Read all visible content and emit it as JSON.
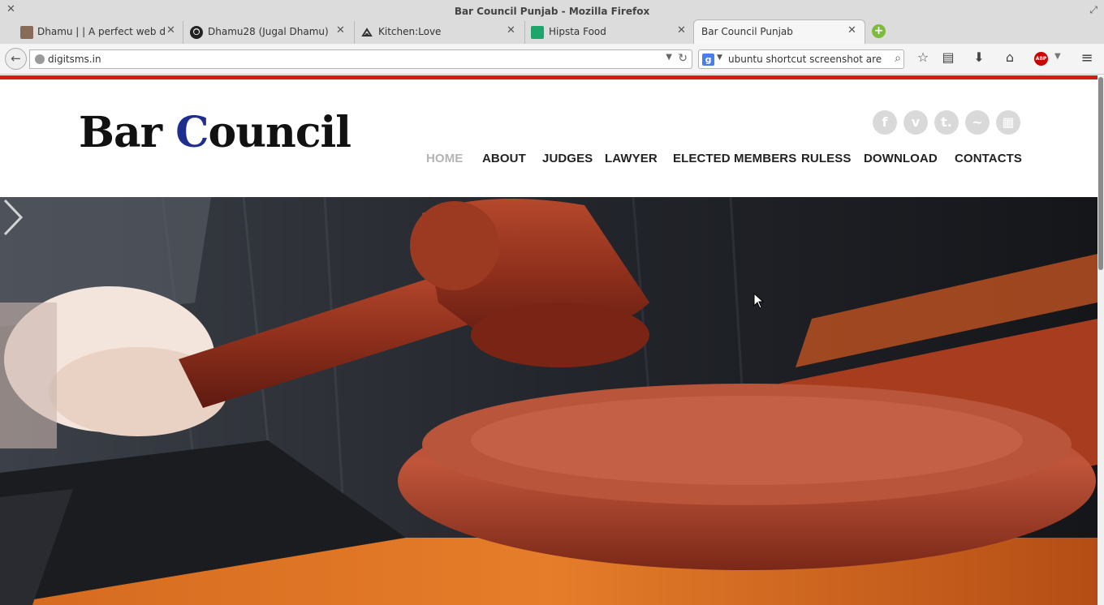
{
  "window": {
    "title": "Bar Council Punjab - Mozilla Firefox"
  },
  "tabs": [
    {
      "label": "Dhamu | | A perfect web d…",
      "favicon": "avatar-photo"
    },
    {
      "label": "Dhamu28 (Jugal Dhamu)",
      "favicon": "github-icon"
    },
    {
      "label": "Kitchen:Love",
      "favicon": "kitchen-icon"
    },
    {
      "label": "Hipsta Food",
      "favicon": "hipsta-icon"
    },
    {
      "label": "Bar Council Punjab",
      "favicon": "none",
      "active": true
    }
  ],
  "toolbar": {
    "url": "digitsms.in",
    "search_query": "ubuntu shortcut screenshot area",
    "search_engine": "Google",
    "icons": [
      "back-icon",
      "reload-icon",
      "search-icon",
      "bookmark-star-icon",
      "reading-list-icon",
      "downloads-icon",
      "home-icon",
      "adblock-plus-icon",
      "menu-icon"
    ]
  },
  "site": {
    "logo_part1": "Bar ",
    "logo_c": "C",
    "logo_part2": "ouncil",
    "social": [
      {
        "name": "facebook-icon",
        "glyph": "f"
      },
      {
        "name": "vimeo-icon",
        "glyph": "v"
      },
      {
        "name": "tumblr-icon",
        "glyph": "t."
      },
      {
        "name": "twitter-icon",
        "glyph": "~"
      },
      {
        "name": "delicious-icon",
        "glyph": "▦"
      }
    ],
    "nav": [
      "HOME",
      "ABOUT",
      "JUDGES",
      "LAWYER",
      "ELECTED MEMBERS",
      "RULESS",
      "DOWNLOAD",
      "CONTACTS"
    ],
    "current_nav": "HOME",
    "hero_alt": "gavel slider image",
    "colors": {
      "accent_rule": "#d21b1b",
      "logo_c": "#1f2d8f",
      "nav_active": "#b4b4b4"
    }
  }
}
